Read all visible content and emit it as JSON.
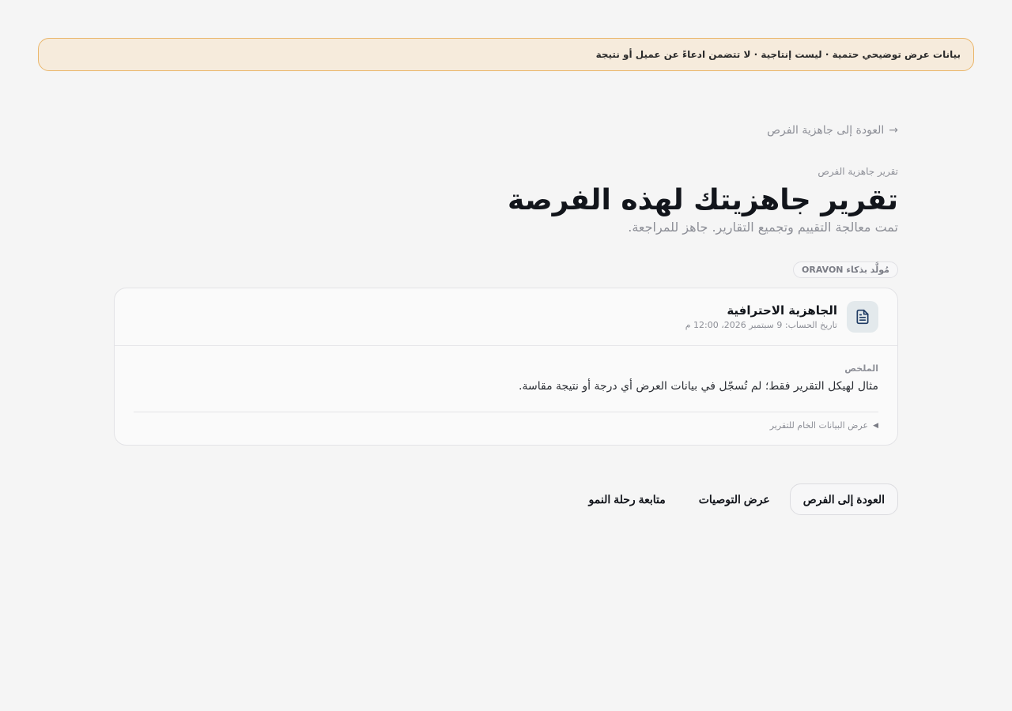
{
  "banner": {
    "text": "بيانات عرض توضيحي حتمية · ليست إنتاجية · لا تتضمن ادعاءً عن عميل أو نتيجة"
  },
  "nav": {
    "back_label": "العودة إلى جاهزية الفرص"
  },
  "header": {
    "eyebrow": "تقرير جاهزية الفرص",
    "title": "تقرير جاهزيتك لهذه الفرصة",
    "subtitle": "تمت معالجة التقييم وتجميع التقارير. جاهز للمراجعة."
  },
  "badge": {
    "label": "مُولَّد بذكاء ORAVON"
  },
  "report": {
    "icon": "document-icon",
    "title": "الجاهزية الاحترافية",
    "computed_at": "تاريخ الحساب: 9 سبتمبر 2026، 12:00 م",
    "summary_label": "الملخص",
    "summary_text": "مثال لهيكل التقرير فقط؛ لم تُسجّل في بيانات العرض أي درجة أو نتيجة مقاسة.",
    "raw_toggle_label": "عرض البيانات الخام للتقرير"
  },
  "actions": {
    "back_label": "العودة إلى الفرص",
    "recommendations_label": "عرض التوصيات",
    "growth_label": "متابعة رحلة النمو"
  },
  "colors": {
    "banner_bg": "#f6ebdc",
    "banner_border": "#eab66b",
    "icon_color": "#1f3b63"
  }
}
